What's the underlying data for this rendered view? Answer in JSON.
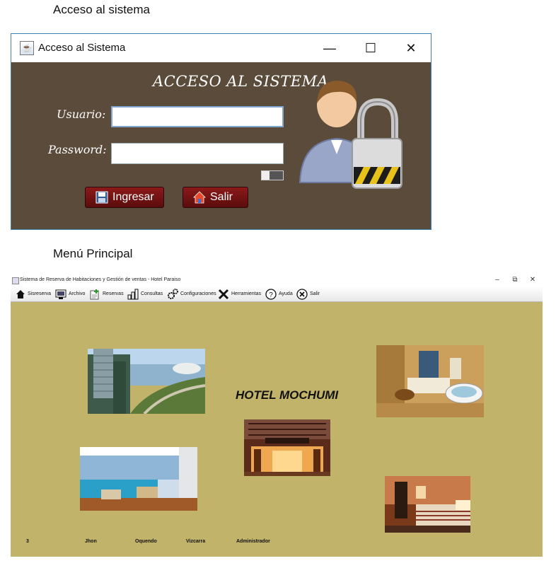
{
  "captions": {
    "login": "Acceso al sistema",
    "menu": "Menú Principal"
  },
  "login": {
    "window_title": "Acceso al Sistema",
    "heading": "ACCESO AL SISTEMA",
    "user_label": "Usuario:",
    "password_label": "Password:",
    "user_value": "",
    "password_value": "",
    "ingresar_label": "Ingresar",
    "salir_label": "Salir",
    "window_buttons": {
      "minimize": "—",
      "maximize": "☐",
      "close": "✕"
    }
  },
  "main": {
    "window_title": "Sistema de Reserva de Habitaciones y Gestión de ventas - Hotel Paraiso",
    "window_buttons": {
      "minimize": "–",
      "restore": "⧉",
      "close": "✕"
    },
    "menu": [
      {
        "label": "Sisreserva",
        "icon": "home-icon"
      },
      {
        "label": "Archivo",
        "icon": "file-icon"
      },
      {
        "label": "Reservas",
        "icon": "reservation-icon"
      },
      {
        "label": "Consultas",
        "icon": "chart-icon"
      },
      {
        "label": "Configuraciones",
        "icon": "gears-icon"
      },
      {
        "label": "Herramientas",
        "icon": "tools-icon"
      },
      {
        "label": "Ayuda",
        "icon": "help-icon"
      },
      {
        "label": "Salir",
        "icon": "exit-icon"
      }
    ],
    "hotel_name": "HOTEL MOCHUMI",
    "status": {
      "id": "3",
      "first_name": "Jhon",
      "last_name1": "Oquendo",
      "last_name2": "Vizcarra",
      "role": "Administrador"
    },
    "colors": {
      "background": "#c2b36a",
      "login_bg": "#5b4b3b",
      "button_red": "#7a1414"
    }
  }
}
